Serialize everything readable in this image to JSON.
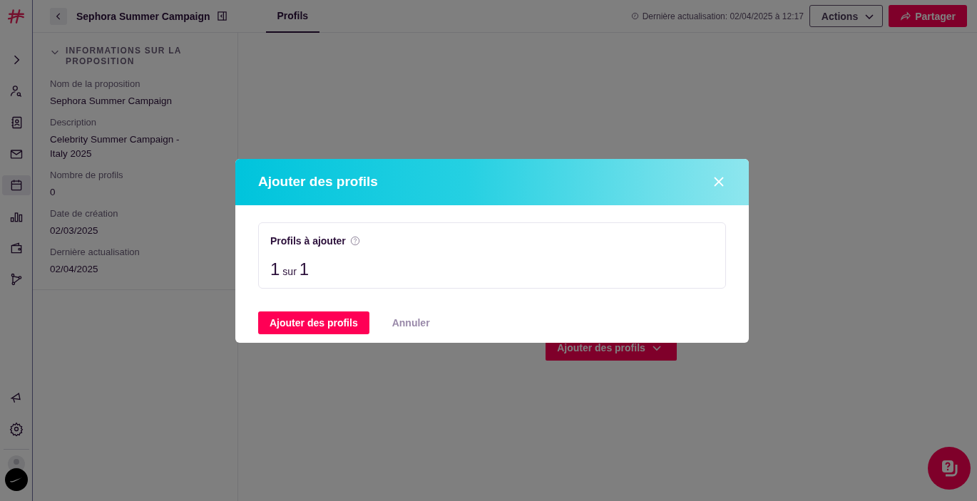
{
  "header": {
    "title": "Sephora Summer Campaign",
    "tabs": [
      {
        "label": "Profils",
        "selected": true
      }
    ],
    "last_update": "Dernière actualisation: 02/04/2025 à 12:17",
    "actions_button": "Actions",
    "share_button": "Partager"
  },
  "nav_items": [
    {
      "selected": false
    },
    {
      "selected": false
    },
    {
      "selected": false
    },
    {
      "selected": true
    },
    {
      "selected": false
    },
    {
      "selected": false
    },
    {
      "selected": false
    }
  ],
  "info_panel": {
    "section_title": "INFORMATIONS SUR LA PROPOSITION",
    "expanded": true,
    "fields": [
      {
        "label": "Nom de la proposition",
        "value": "Sephora Summer Campaign"
      },
      {
        "label": "Description",
        "value": "Celebrity Summer Campaign - Italy 2025"
      },
      {
        "label": "Nombre de profils",
        "value": "0"
      },
      {
        "label": "Date de création",
        "value": "02/03/2025"
      },
      {
        "label": "Dernière actualisation",
        "value": "02/04/2025"
      }
    ]
  },
  "main": {
    "add_button": "Ajouter des profils"
  },
  "dialog": {
    "title": "Ajouter des profils",
    "field_label": "Profils à ajouter",
    "count": "1",
    "separator": "sur",
    "total": "1",
    "confirm_button": "Ajouter des profils",
    "cancel_button": "Annuler"
  }
}
